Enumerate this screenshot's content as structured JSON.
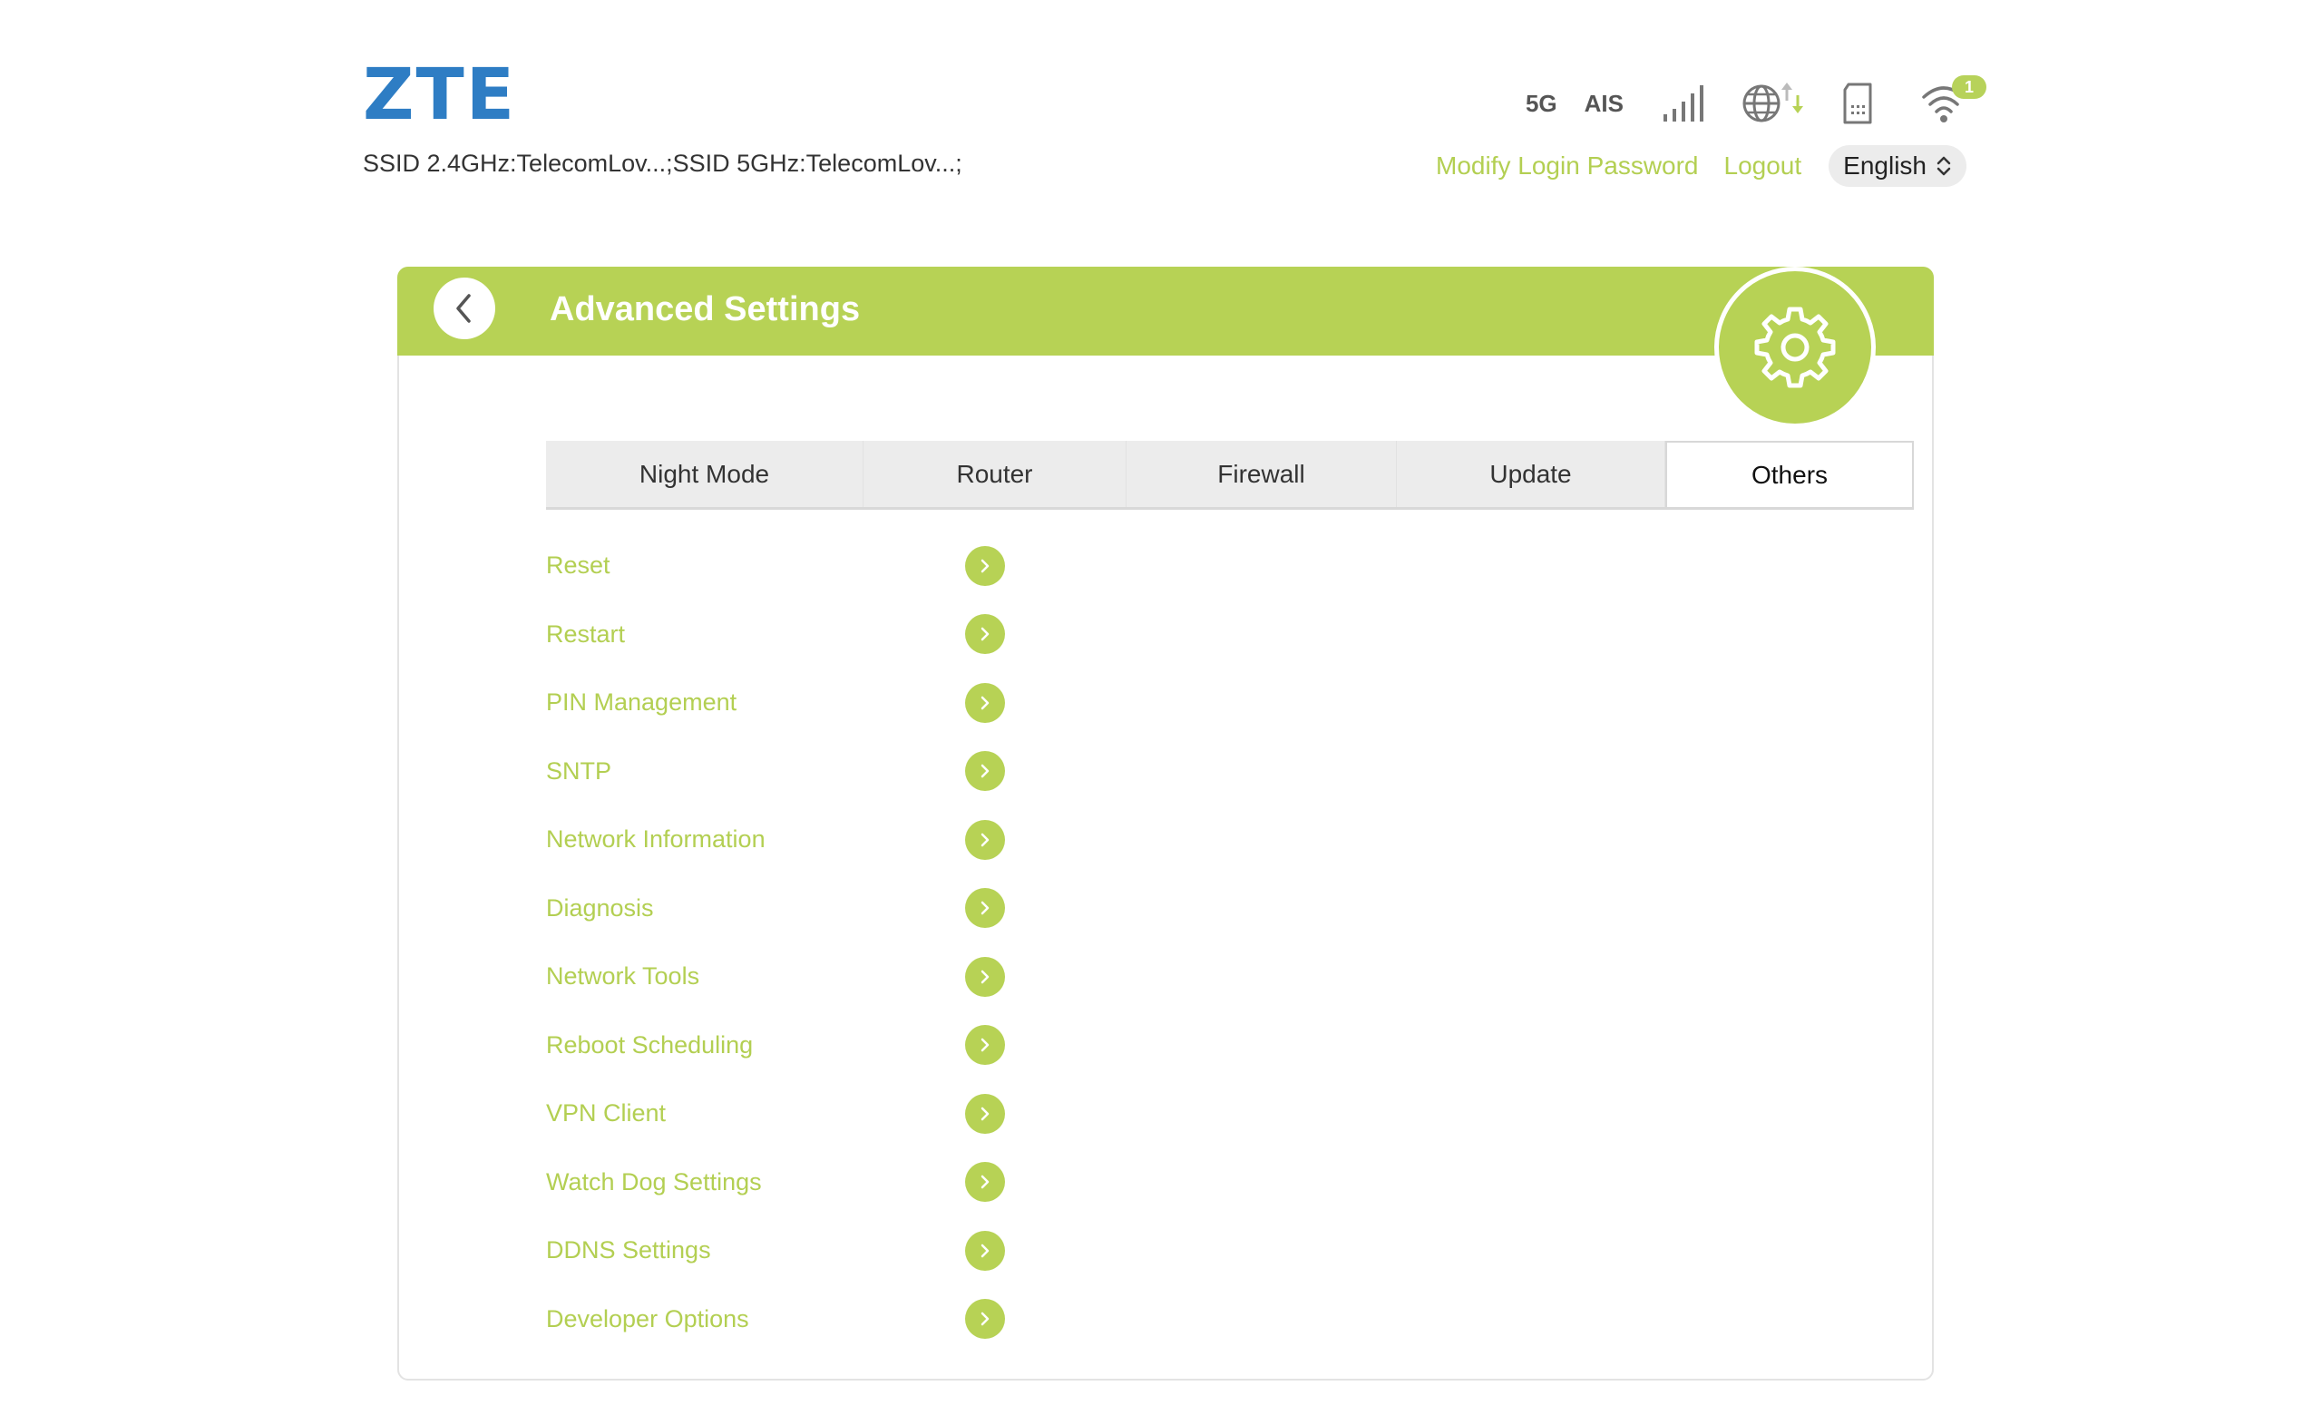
{
  "brand": {
    "logo": "ZTE",
    "ssid_line": "SSID 2.4GHz:TelecomLov...;SSID 5GHz:TelecomLov...;"
  },
  "status": {
    "network_type": "5G",
    "operator": "AIS",
    "wifi_clients": "1",
    "icons": [
      "signal-strength-icon",
      "globe-data-icon",
      "sim-card-icon",
      "wifi-icon"
    ]
  },
  "user_links": {
    "modify_password": "Modify Login Password",
    "logout": "Logout",
    "language": "English"
  },
  "panel": {
    "title": "Advanced Settings"
  },
  "tabs": [
    {
      "label": "Night Mode",
      "active": false
    },
    {
      "label": "Router",
      "active": false
    },
    {
      "label": "Firewall",
      "active": false
    },
    {
      "label": "Update",
      "active": false
    },
    {
      "label": "Others",
      "active": true
    }
  ],
  "menu": [
    {
      "label": "Reset"
    },
    {
      "label": "Restart"
    },
    {
      "label": "PIN Management"
    },
    {
      "label": "SNTP"
    },
    {
      "label": "Network Information"
    },
    {
      "label": "Diagnosis"
    },
    {
      "label": "Network Tools"
    },
    {
      "label": "Reboot Scheduling"
    },
    {
      "label": "VPN Client"
    },
    {
      "label": "Watch Dog Settings"
    },
    {
      "label": "DDNS Settings"
    },
    {
      "label": "Developer Options"
    }
  ],
  "colors": {
    "accent": "#b7d255",
    "link": "#b3cf52",
    "logo": "#2e7dc4"
  }
}
